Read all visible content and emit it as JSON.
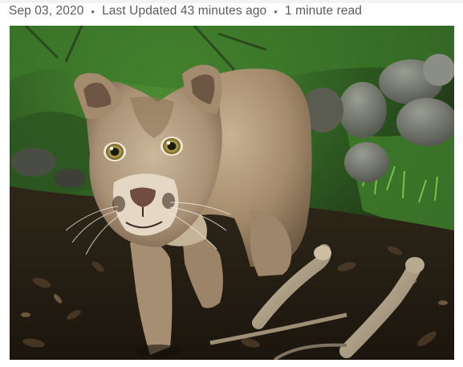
{
  "article_meta": {
    "date": "Sep 03, 2020",
    "separator": "•",
    "updated": "Last Updated 43 minutes ago",
    "read_time": "1 minute read"
  },
  "photo": {
    "subject": "mountain-lion",
    "palette": {
      "foliage": "#3f7a2c",
      "foliage_light": "#6fae45",
      "ground": "#2b2116",
      "rock": "#7d8175",
      "fur": "#b59d7f",
      "fur_light": "#d9c8ae",
      "eye": "#c9b45a"
    }
  }
}
